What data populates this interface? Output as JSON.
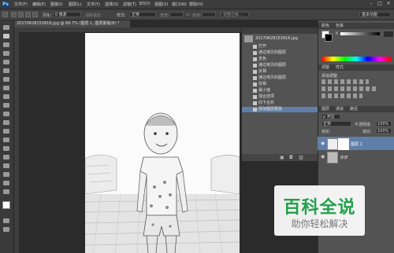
{
  "app": {
    "logo": "Ps"
  },
  "menu": [
    "文件(F)",
    "编辑(E)",
    "图像(I)",
    "图层(L)",
    "文字(Y)",
    "选择(S)",
    "滤镜(T)",
    "3D(D)",
    "视图(V)",
    "窗口(W)",
    "帮助(H)"
  ],
  "options": {
    "feather_label": "羽化:",
    "feather_value": "0 像素",
    "antialias_label": "消除锯齿",
    "style_label": "样式:",
    "style_value": "正常",
    "width_label": "宽度:",
    "height_label": "高度:",
    "refine_button": "调整边缘...",
    "workspace": "基本功能"
  },
  "document": {
    "tab_title": "20170628153916.jpg @ 66.7% (图层 1, 图层蒙版/8) *"
  },
  "history": {
    "snapshot_name": "20170628153916.jpg",
    "items": [
      "打开",
      "通过拷贝的图层",
      "去色",
      "通过拷贝的图层",
      "反相",
      "通过拷贝的图层",
      "反相",
      "最小值",
      "混合选项",
      "向下合并",
      "添加图层蒙版"
    ]
  },
  "panels": {
    "color_tab": "颜色",
    "swatches_tab": "色板",
    "adjust_tab": "调整",
    "styles_tab": "样式",
    "adjust_title": "添加调整",
    "layers_tab": "图层",
    "channels_tab": "通道",
    "paths_tab": "路径",
    "kind_label": "p 类型",
    "blend_mode": "正常",
    "opacity_label": "不透明度:",
    "opacity_value": "100%",
    "lock_label": "锁定:",
    "fill_label": "填充:",
    "fill_value": "100%",
    "layers": [
      {
        "name": "图层 1"
      },
      {
        "name": "背景"
      }
    ]
  },
  "watermark": {
    "title": "百科全说",
    "subtitle": "助你轻松解决"
  },
  "colors": {
    "menubar": "#3c3c3c",
    "panel": "#535353",
    "selected_row": "#5f7fa8",
    "watermark_green": "#22a04a"
  }
}
